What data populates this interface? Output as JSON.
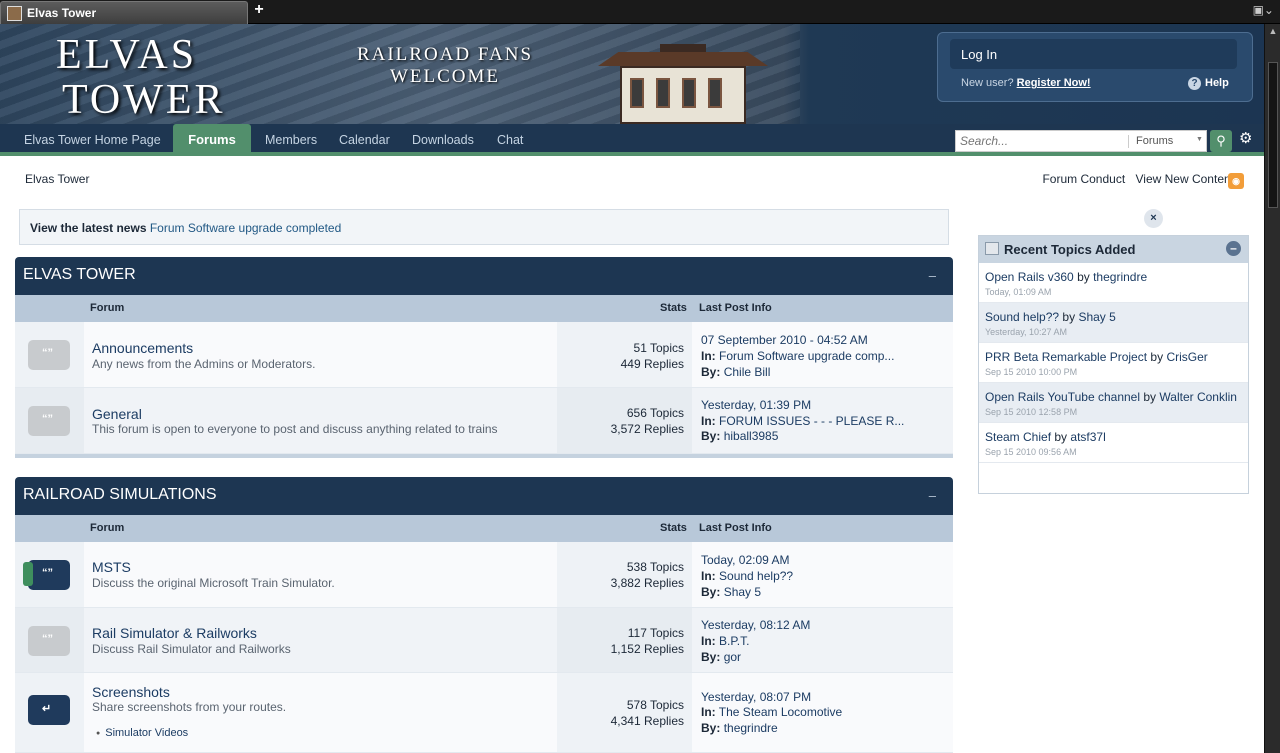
{
  "browser": {
    "tab_title": "Elvas Tower",
    "new_tab": "+"
  },
  "header": {
    "logo_line1": "ELVAS",
    "logo_line2": "TOWER",
    "tagline1": "RAILROAD FANS",
    "tagline2": "WELCOME",
    "login_label": "Log In",
    "new_user_text": "New user?",
    "register_label": "Register Now!",
    "help_label": "Help"
  },
  "nav": {
    "items": [
      "Elvas Tower Home Page",
      "Forums",
      "Members",
      "Calendar",
      "Downloads",
      "Chat"
    ],
    "search_placeholder": "Search...",
    "search_scope": "Forums"
  },
  "breadcrumb": "Elvas Tower",
  "toplinks": [
    "Forum Conduct",
    "View New Content"
  ],
  "news": {
    "label": "View the latest news",
    "link": "Forum Software upgrade completed"
  },
  "columns": {
    "forum": "Forum",
    "stats": "Stats",
    "last_post": "Last Post Info"
  },
  "categories": [
    {
      "title": "ELVAS TOWER",
      "toggle": "–",
      "forums": [
        {
          "name": "Announcements",
          "desc": "Any news from the Admins or Moderators.",
          "topics": "51 Topics",
          "replies": "449 Replies",
          "date": "07 September 2010 - 04:52 AM",
          "in_label": "In:",
          "in": "Forum Software upgrade comp...",
          "by_label": "By:",
          "by": "Chile Bill"
        },
        {
          "name": "General",
          "desc": "This forum is open to everyone to post and discuss anything related to trains",
          "topics": "656 Topics",
          "replies": "3,572 Replies",
          "date": "Yesterday, 01:39 PM",
          "in_label": "In:",
          "in": "FORUM ISSUES - - - PLEASE R...",
          "by_label": "By:",
          "by": "hiball3985"
        }
      ]
    },
    {
      "title": "RAILROAD SIMULATIONS",
      "toggle": "–",
      "forums": [
        {
          "name": "MSTS",
          "desc": "Discuss the original Microsoft Train Simulator.",
          "topics": "538 Topics",
          "replies": "3,882 Replies",
          "date": "Today, 02:09 AM",
          "in_label": "In:",
          "in": "Sound help??",
          "by_label": "By:",
          "by": "Shay 5"
        },
        {
          "name": "Rail Simulator & Railworks",
          "desc": "Discuss Rail Simulator and Railworks",
          "topics": "117 Topics",
          "replies": "1,152 Replies",
          "date": "Yesterday, 08:12 AM",
          "in_label": "In:",
          "in": "B.P.T.",
          "by_label": "By:",
          "by": "gor"
        },
        {
          "name": "Screenshots",
          "desc": "Share screenshots from your routes.",
          "subforum": "Simulator Videos",
          "topics": "578 Topics",
          "replies": "4,341 Replies",
          "date": "Yesterday, 08:07 PM",
          "in_label": "In:",
          "in": "The Steam Locomotive",
          "by_label": "By:",
          "by": "thegrindre"
        }
      ]
    }
  ],
  "sidebar": {
    "close": "×",
    "title": "Recent Topics Added",
    "toggle": "–",
    "items": [
      {
        "topic": "Open Rails v360",
        "by": "by",
        "author": "thegrindre",
        "date": "Today, 01:09 AM"
      },
      {
        "topic": "Sound help??",
        "by": "by",
        "author": "Shay 5",
        "date": "Yesterday, 10:27 AM"
      },
      {
        "topic": "PRR Beta Remarkable Project",
        "by": "by",
        "author": "CrisGer",
        "date": "Sep 15 2010 10:00 PM"
      },
      {
        "topic": "Open Rails YouTube channel",
        "by": "by",
        "author": "Walter Conklin",
        "date": "Sep 15 2010 12:58 PM"
      },
      {
        "topic": "Steam Chief",
        "by": "by",
        "author": "atsf37l",
        "date": "Sep 15 2010 09:56 AM"
      }
    ]
  }
}
